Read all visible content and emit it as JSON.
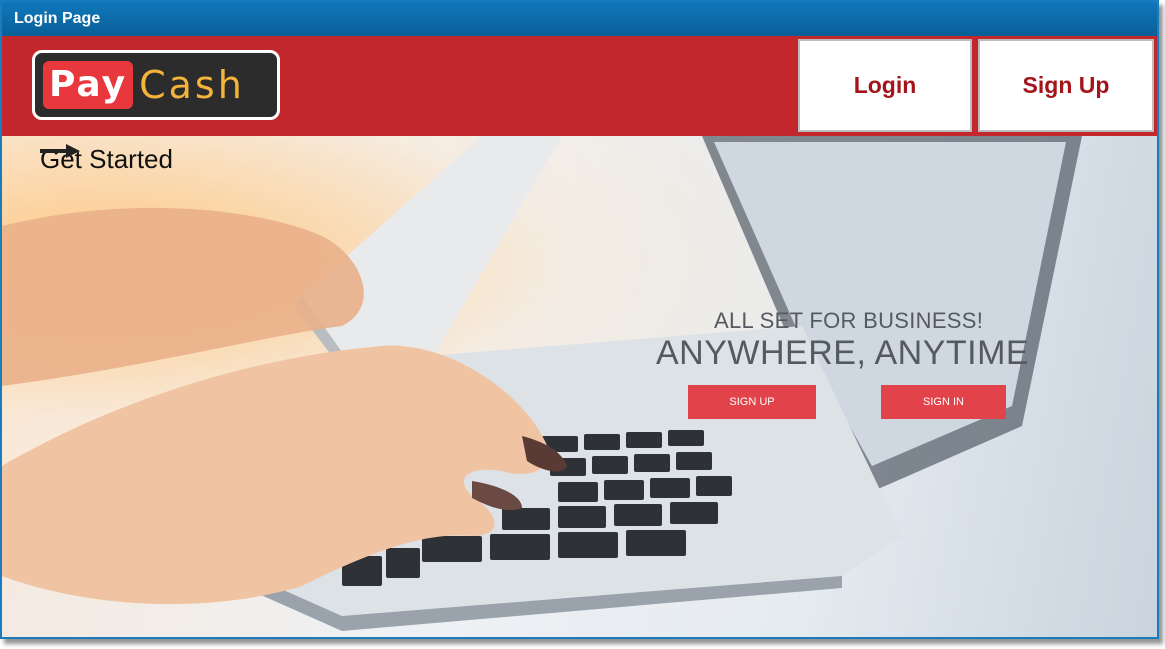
{
  "window": {
    "title": "Login Page"
  },
  "header": {
    "logo": {
      "part1": "Pay",
      "part2": "Cash"
    },
    "nav": {
      "login_label": "Login",
      "signup_label": "Sign Up"
    }
  },
  "hero": {
    "get_started": "Get Started",
    "tagline_line1": "ALL SET FOR BUSINESS!",
    "tagline_line2": "ANYWHERE, ANYTIME",
    "signup_button": "SIGN UP",
    "signin_button": "SIGN IN"
  },
  "colors": {
    "titlebar": "#0f78bb",
    "header": "#c1272d",
    "nav_text": "#a3151b",
    "hero_button": "#e2434a",
    "logo_accent": "#f3b43a"
  }
}
